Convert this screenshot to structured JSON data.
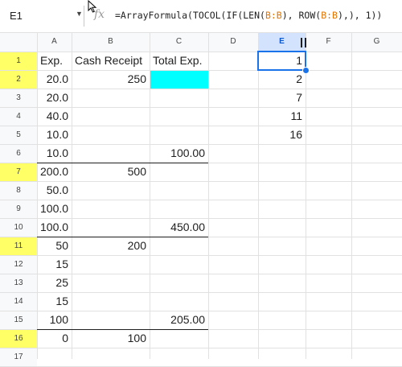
{
  "formula_bar": {
    "name_box": "E1",
    "fx_label": "fx",
    "formula_parts": [
      {
        "t": "=ArrayFormula(TOCOL(IF(LEN(",
        "ref": false
      },
      {
        "t": "B:B",
        "ref": true
      },
      {
        "t": "), ROW(",
        "ref": false
      },
      {
        "t": "B:B",
        "ref": true
      },
      {
        "t": "),), 1))",
        "ref": false
      }
    ]
  },
  "columns": [
    "A",
    "B",
    "C",
    "D",
    "E",
    "F",
    "G"
  ],
  "selected_column": "E",
  "rows": [
    "1",
    "2",
    "3",
    "4",
    "5",
    "6",
    "7",
    "8",
    "9",
    "10",
    "11",
    "12",
    "13",
    "14",
    "15",
    "16",
    "17"
  ],
  "highlighted_rows": [
    "1",
    "2",
    "7",
    "11",
    "16"
  ],
  "cells": {
    "A": [
      "Exp.",
      "20.0",
      "20.0",
      "40.0",
      "10.0",
      "10.0",
      "200.0",
      "50.0",
      "100.0",
      "100.0",
      "50",
      "15",
      "25",
      "15",
      "100",
      "0",
      ""
    ],
    "B": [
      "Cash Receipt",
      "250",
      "",
      "",
      "",
      "",
      "500",
      "",
      "",
      "",
      "200",
      "",
      "",
      "",
      "",
      "100",
      ""
    ],
    "C": [
      "Total Exp.",
      "",
      "",
      "",
      "",
      "100.00",
      "",
      "",
      "",
      "450.00",
      "",
      "",
      "",
      "",
      "205.00",
      "",
      ""
    ],
    "E": [
      "1",
      "2",
      "7",
      "11",
      "16",
      "",
      "",
      "",
      "",
      "",
      "",
      "",
      "",
      "",
      "",
      "",
      ""
    ]
  },
  "colors": {
    "cyan_fill": "#00ffff",
    "row_highlight": "#ffff66",
    "selection": "#1a73e8",
    "formula_ref": "#e37400"
  }
}
